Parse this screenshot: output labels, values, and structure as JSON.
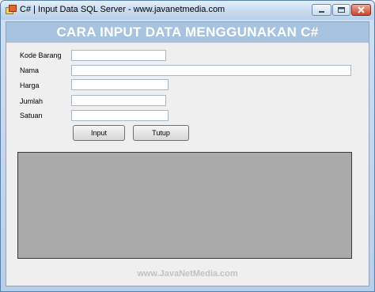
{
  "window": {
    "title": "C# | Input Data SQL Server - www.javanetmedia.com",
    "icon": "csharp-app-icon"
  },
  "header": {
    "banner": "CARA INPUT DATA MENGGUNAKAN C#"
  },
  "form": {
    "kode_barang": {
      "label": "Kode Barang",
      "value": ""
    },
    "nama": {
      "label": "Nama",
      "value": ""
    },
    "harga": {
      "label": "Harga",
      "value": ""
    },
    "jumlah": {
      "label": "Jumlah",
      "value": ""
    },
    "satuan": {
      "label": "Satuan",
      "value": ""
    }
  },
  "buttons": {
    "input_label": "Input",
    "tutup_label": "Tutup"
  },
  "footer": {
    "text": "www.JavaNetMedia.com"
  },
  "colors": {
    "banner": "#a8c3e0",
    "grid_background": "#aaaaaa",
    "client_background": "#efefef"
  }
}
